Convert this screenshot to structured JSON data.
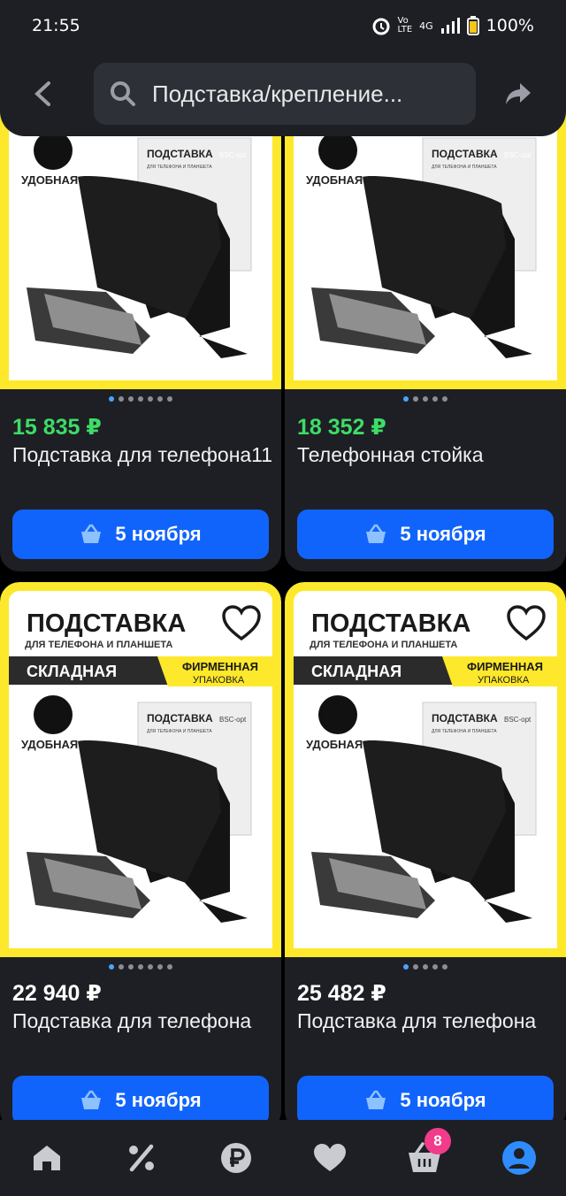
{
  "status_bar": {
    "time": "21:55",
    "battery": "100%",
    "network": "4G"
  },
  "search": {
    "query": "Подставка/крепление..."
  },
  "products": [
    {
      "price": "15 835 ₽",
      "price_color": "#3ddc67",
      "title": "Подставка для телефона11",
      "delivery": "5 ноября"
    },
    {
      "price": "18 352 ₽",
      "price_color": "#3ddc67",
      "title": "Телефонная стойка",
      "delivery": "5 ноября"
    },
    {
      "price": "22 940 ₽",
      "price_color": "#ffffff",
      "title": "Подставка для телефона",
      "delivery": "5 ноября",
      "image_text": {
        "headline": "ПОДСТАВКА",
        "sub": "ДЛЯ ТЕЛЕФОНА И ПЛАНШЕТА",
        "fold": "СКЛАДНАЯ",
        "brand1": "ФИРМЕННАЯ",
        "brand2": "УПАКОВКА"
      }
    },
    {
      "price": "25 482 ₽",
      "price_color": "#ffffff",
      "title": "Подставка для телефона",
      "delivery": "5 ноября",
      "image_text": {
        "headline": "ПОДСТАВКА",
        "sub": "ДЛЯ ТЕЛЕФОНА И ПЛАНШЕТА",
        "fold": "СКЛАДНАЯ",
        "brand1": "ФИРМЕННАЯ",
        "brand2": "УПАКОВКА"
      }
    }
  ],
  "image_common": {
    "comfy": "УДОБНАЯ",
    "box_title": "ПОДСТАВКА",
    "box_sub": "ДЛЯ ТЕЛЕФОНА И ПЛАНШЕТА",
    "box_tag": "BSC-opt"
  },
  "nav": {
    "cart_badge": "8"
  },
  "colors": {
    "accent": "#1164fb",
    "card": "#1e1f24",
    "badge": "#f23b8a",
    "frame": "#fde82b"
  }
}
